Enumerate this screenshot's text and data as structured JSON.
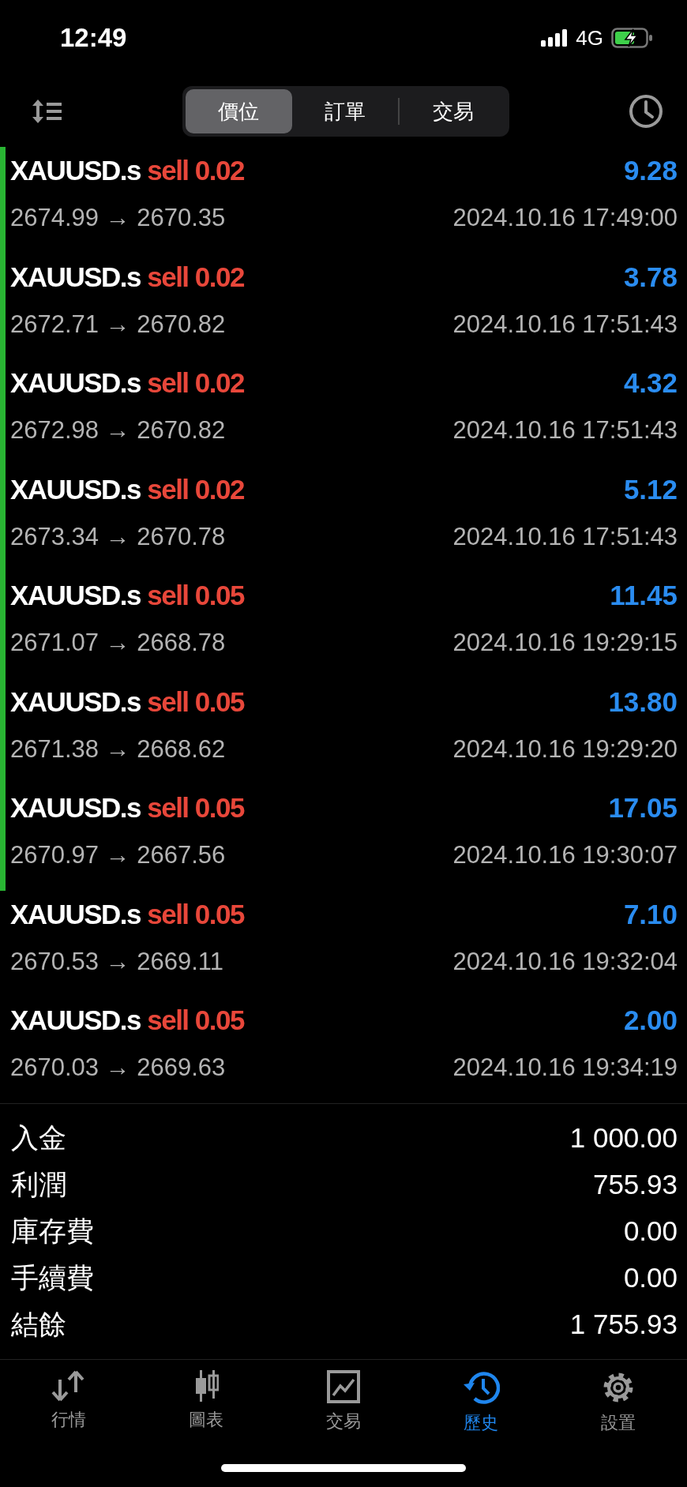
{
  "status_bar": {
    "time": "12:49",
    "network": "4G"
  },
  "segments": [
    {
      "label": "價位",
      "selected": true
    },
    {
      "label": "訂單",
      "selected": false
    },
    {
      "label": "交易",
      "selected": false
    }
  ],
  "deals": [
    {
      "symbol": "XAUUSD.s",
      "side": "sell 0.02",
      "profit": "9.28",
      "prices": "2674.99 → 2670.35",
      "time": "2024.10.16 17:49:00",
      "marked": true
    },
    {
      "symbol": "XAUUSD.s",
      "side": "sell 0.02",
      "profit": "3.78",
      "prices": "2672.71 → 2670.82",
      "time": "2024.10.16 17:51:43",
      "marked": true
    },
    {
      "symbol": "XAUUSD.s",
      "side": "sell 0.02",
      "profit": "4.32",
      "prices": "2672.98 → 2670.82",
      "time": "2024.10.16 17:51:43",
      "marked": true
    },
    {
      "symbol": "XAUUSD.s",
      "side": "sell 0.02",
      "profit": "5.12",
      "prices": "2673.34 → 2670.78",
      "time": "2024.10.16 17:51:43",
      "marked": true
    },
    {
      "symbol": "XAUUSD.s",
      "side": "sell 0.05",
      "profit": "11.45",
      "prices": "2671.07 → 2668.78",
      "time": "2024.10.16 19:29:15",
      "marked": true
    },
    {
      "symbol": "XAUUSD.s",
      "side": "sell 0.05",
      "profit": "13.80",
      "prices": "2671.38 → 2668.62",
      "time": "2024.10.16 19:29:20",
      "marked": true
    },
    {
      "symbol": "XAUUSD.s",
      "side": "sell 0.05",
      "profit": "17.05",
      "prices": "2670.97 → 2667.56",
      "time": "2024.10.16 19:30:07",
      "marked": true
    },
    {
      "symbol": "XAUUSD.s",
      "side": "sell 0.05",
      "profit": "7.10",
      "prices": "2670.53 → 2669.11",
      "time": "2024.10.16 19:32:04",
      "marked": false
    },
    {
      "symbol": "XAUUSD.s",
      "side": "sell 0.05",
      "profit": "2.00",
      "prices": "2670.03 → 2669.63",
      "time": "2024.10.16 19:34:19",
      "marked": false
    }
  ],
  "summary": [
    {
      "label": "入金",
      "value": "1 000.00"
    },
    {
      "label": "利潤",
      "value": "755.93"
    },
    {
      "label": "庫存費",
      "value": "0.00"
    },
    {
      "label": "手續費",
      "value": "0.00"
    },
    {
      "label": "結餘",
      "value": "1 755.93"
    }
  ],
  "tab_bar": [
    {
      "kind": "quotes",
      "label": "行情",
      "selected": false
    },
    {
      "kind": "chart",
      "label": "圖表",
      "selected": false
    },
    {
      "kind": "trade",
      "label": "交易",
      "selected": false
    },
    {
      "kind": "history",
      "label": "歷史",
      "selected": true
    },
    {
      "kind": "settings",
      "label": "設置",
      "selected": false
    }
  ]
}
